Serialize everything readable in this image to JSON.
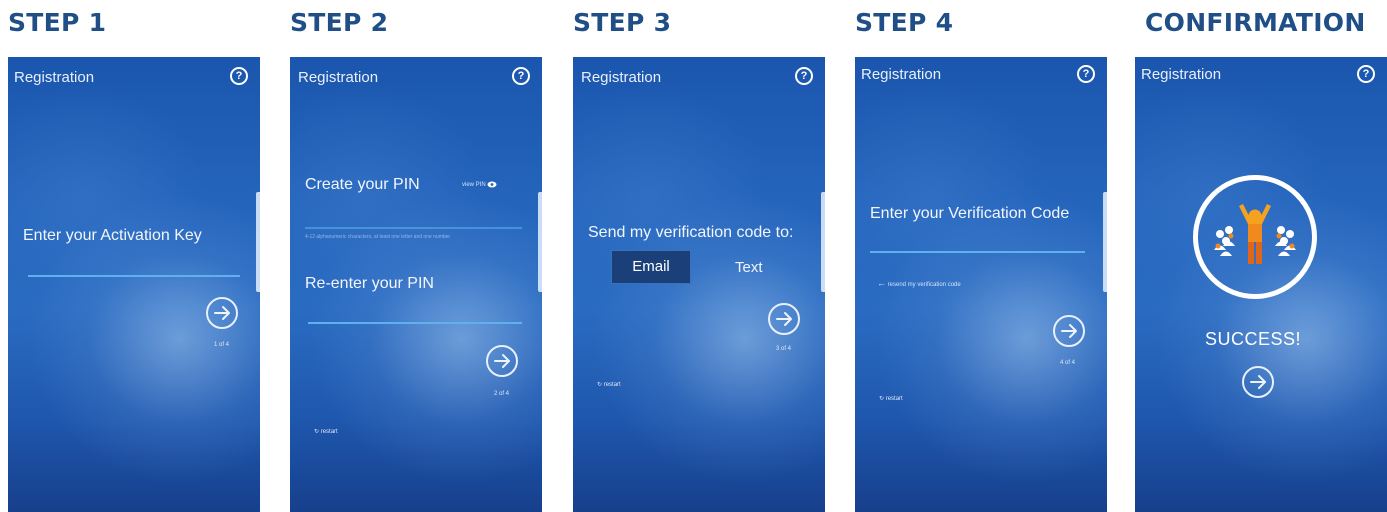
{
  "steps": [
    {
      "heading": "STEP 1",
      "app_title": "Registration",
      "prompt": "Enter your Activation Key",
      "pager": "1 of 4"
    },
    {
      "heading": "STEP 2",
      "app_title": "Registration",
      "prompt": "Create your PIN",
      "view_pin": "view PIN",
      "hint": "4-12 alphanumeric characters, at least one letter and one number",
      "prompt2": "Re-enter your PIN",
      "pager": "2 of 4",
      "restart": "restart"
    },
    {
      "heading": "STEP 3",
      "app_title": "Registration",
      "prompt": "Send my verification code to:",
      "email": "Email",
      "text": "Text",
      "pager": "3 of 4",
      "restart": "restart"
    },
    {
      "heading": "STEP 4",
      "app_title": "Registration",
      "prompt": "Enter your Verification Code",
      "resend": "resend my verification code",
      "pager": "4 of 4",
      "restart": "restart"
    },
    {
      "heading": "CONFIRMATION",
      "app_title": "Registration",
      "success": "SUCCESS!"
    }
  ],
  "icons": {
    "help": "question-circle-icon",
    "next": "arrow-right-circle-icon",
    "restart": "restart-arrow-icon",
    "back": "arrow-left-icon",
    "eye": "eye-icon",
    "success": "people-celebrating-icon"
  },
  "colors": {
    "heading": "#1f4f86",
    "screen_blue": "#2566bd",
    "input_line": "#5fb0ee",
    "email_selected": "#1b3f78",
    "success_orange": "#f0931e"
  }
}
